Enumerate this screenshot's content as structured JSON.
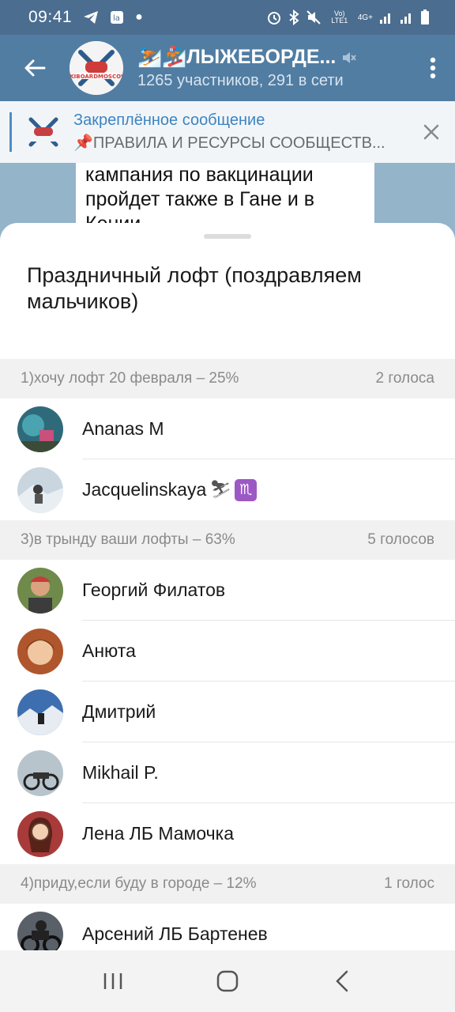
{
  "status_bar": {
    "time": "09:41",
    "network": "4G+",
    "lte": "Vo) LTE1"
  },
  "app_bar": {
    "title": "⛷️🏂ЛЫЖЕБОРДЕ...",
    "subtitle": "1265 участников, 291 в сети",
    "avatar_logo_text": "SKIBOARDMOSCOW"
  },
  "pinned": {
    "title": "Закреплённое сообщение",
    "message": "📌ПРАВИЛА И РЕСУРСЫ СООБЩЕСТВ..."
  },
  "chat_bubble_text": "кампания по вакцинации пройдет также в Гане и в Кении",
  "poll": {
    "question": "Праздничный лофт (поздравляем мальчиков)",
    "options": [
      {
        "label": "1)хочу лофт 20 февраля – 25%",
        "votes": "2 голоса",
        "voters": [
          {
            "name": "Ananas M",
            "avatar_color": "#2f6a7a"
          },
          {
            "name": "Jacquelinskaya",
            "avatar_color": "#a9bccb"
          }
        ]
      },
      {
        "label": "3)в трынду ваши лофты – 63%",
        "votes": "5 голосов",
        "voters": [
          {
            "name": "Георгий Филатов",
            "avatar_color": "#5c6e3a"
          },
          {
            "name": "Анюта",
            "avatar_color": "#c98a52"
          },
          {
            "name": "Дмитрий",
            "avatar_color": "#3f5c8c"
          },
          {
            "name": "Mikhail P.",
            "avatar_color": "#6f7a82"
          },
          {
            "name": "Лена ЛБ Мамочка",
            "avatar_color": "#8c3b3b"
          }
        ]
      },
      {
        "label": "4)приду,если буду в городе – 12%",
        "votes": "1 голос",
        "voters": [
          {
            "name": "Арсений ЛБ Бартенев",
            "avatar_color": "#3a3f45"
          }
        ]
      }
    ]
  },
  "colors": {
    "header": "#517da2",
    "status_bar": "#4b6d8f",
    "pinned_title": "#3a85c4"
  }
}
